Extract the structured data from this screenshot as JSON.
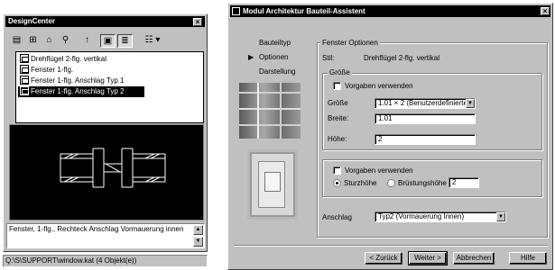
{
  "design_center": {
    "title": "DesignCenter",
    "toolbar_icons": [
      "folder-tree-icon",
      "open-folder-icon",
      "load-icon",
      "find-icon",
      "up-icon",
      "preview-icon",
      "description-icon",
      "views-icon"
    ],
    "items": [
      {
        "label": "Drehflügel 2-flg. vertikal",
        "selected": false
      },
      {
        "label": "Fenster 1-flg.",
        "selected": false
      },
      {
        "label": "Fenster 1-flg. Anschlag Typ 1",
        "selected": false
      },
      {
        "label": "Fenster 1-flg. Anschlag Typ 2",
        "selected": true
      }
    ],
    "description": "Fenster, 1-flg., Rechteck Anschlag Vormauerung innen",
    "status": "Q:\\S\\SUPPORT\\window.kat (4 Objekt(e))"
  },
  "wizard": {
    "title": "Modul Architektur Bauteil-Assistent",
    "steps": [
      {
        "label": "Bauteiltyp",
        "active": false
      },
      {
        "label": "Optionen",
        "active": true
      },
      {
        "label": "Darstellung",
        "active": false
      }
    ],
    "options_title": "Fenster Optionen",
    "stil_label": "Stil:",
    "stil_value": "Drehflügel 2-flg. vertikal",
    "groesse_group": "Größe",
    "vorgaben_label": "Vorgaben verwenden",
    "groesse_label": "Größe",
    "groesse_value": "1.01 × 2 (Benutzerdefinierte Grö",
    "breite_label": "Breite:",
    "breite_value": "1.01",
    "hoehe_label": "Höhe:",
    "hoehe_value": "2",
    "vorgaben2_label": "Vorgaben verwenden",
    "sturzhoehe_label": "Sturzhöhe",
    "bruestungshoehe_label": "Brüstungshöhe",
    "hoehe2_value": "2",
    "anschlag_label": "Anschlag",
    "anschlag_value": "Typ2 (Vormauerung Innen)",
    "buttons": {
      "back": "< Zurück",
      "next": "Weiter >",
      "cancel": "Abbrechen",
      "help": "Hilfe"
    }
  }
}
